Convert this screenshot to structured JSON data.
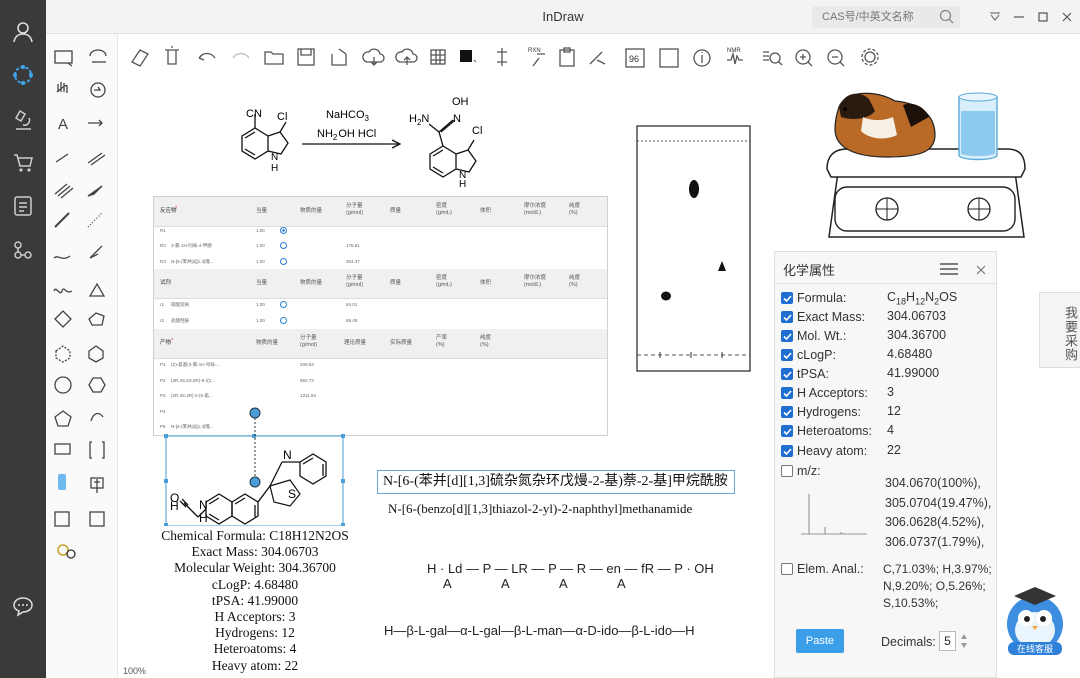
{
  "app": {
    "title": "InDraw"
  },
  "search": {
    "placeholder": "CAS号/中英文名称"
  },
  "rail": {
    "icons": [
      "user-icon",
      "molecule-icon",
      "microscope-icon",
      "cart-icon",
      "document-icon",
      "network-icon",
      "chat-icon"
    ]
  },
  "scheme": {
    "reagent1": "NaHCO",
    "reagent1_sub": "3",
    "reagent2": "NH",
    "reagent2_sub": "2",
    "reagent2_rest": "OH HCl",
    "reactant_labels": {
      "cn": "CN",
      "cl": "Cl",
      "nh": "N",
      "h": "H"
    },
    "product_labels": {
      "oh": "OH",
      "n": "N",
      "h2n": "H",
      "h2n_sub": "2",
      "h2n_n": "N",
      "cl": "Cl",
      "nh": "N",
      "h": "H"
    }
  },
  "table": {
    "reactants": {
      "title": "反应物",
      "headers": [
        "当量",
        "物质的量",
        "分子量 (g/mol)",
        "质量",
        "密度 (g/mL)",
        "体积",
        "摩尔浓度 (mol/L)",
        "纯度 (%)"
      ],
      "rows": [
        {
          "id": "R1",
          "name": "",
          "eq": "1.00",
          "mw": ""
        },
        {
          "id": "R2",
          "name": "3-氯-1H-吲哚-4-甲腈",
          "eq": "1.00",
          "mw": "176.61"
        },
        {
          "id": "R3",
          "name": "N-[6-(苯并[d][1,3]噻...",
          "eq": "1.00",
          "mw": "304.37"
        }
      ]
    },
    "reagents": {
      "title": "试剂",
      "headers": [
        "当量",
        "物质的量",
        "分子量 (g/mol)",
        "质量",
        "密度 (g/mL)",
        "体积",
        "摩尔浓度 (mol/L)",
        "纯度 (%)"
      ],
      "rows": [
        {
          "id": "r1",
          "name": "碳酸氢钠",
          "eq": "1.00",
          "mw": "84.01"
        },
        {
          "id": "r2",
          "name": "盐酸羟胺",
          "eq": "1.00",
          "mw": "69.49"
        }
      ]
    },
    "products": {
      "title": "产物",
      "headers": [
        "物质的量",
        "分子量 (g/mol)",
        "理论质量",
        "实际质量",
        "产率 (%)",
        "纯度 (%)"
      ],
      "rows": [
        {
          "id": "P1",
          "name": "(Z)-氨基(3-氯-1H-吲哚-...",
          "mw": "209.64"
        },
        {
          "id": "P2",
          "name": "(3R,4S,5S,6R)-6-((2...",
          "mw": "892.72"
        },
        {
          "id": "P3",
          "name": "(2R,3S,4R)-2-(6-氨...",
          "mw": "1311.94"
        },
        {
          "id": "P4",
          "name": "",
          "mw": ""
        },
        {
          "id": "P5",
          "name": "N-[6-(苯并[d][1,3]噻...",
          "mw": ""
        }
      ]
    }
  },
  "molecule": {
    "labels": {
      "o": "O",
      "h": "H",
      "n": "N",
      "hn": "H",
      "n2": "N",
      "s": "S"
    },
    "properties_text": [
      "Chemical Formula: C18H12N2OS",
      "Exact Mass: 304.06703",
      "Molecular Weight: 304.36700",
      "cLogP: 4.68480",
      "tPSA: 41.99000",
      "H Acceptors: 3",
      "Hydrogens: 12",
      "Heteroatoms: 4",
      "Heavy atom: 22"
    ]
  },
  "names": {
    "cn": "N-[6-(苯并[d][1,3]硫杂氮杂环戊熳-2-基)萘-2-基]甲烷酰胺",
    "en": "N-[6-(benzo[d][1,3]thiazol-2-yl)-2-naphthyl]methanamide"
  },
  "peptide": {
    "line": "H-Ld-P-LR-P-R-en-fR-P-OH",
    "display": "H · Ld — P — LR — P — R — en — fR — P · OH",
    "sub_marks": [
      "A",
      "A",
      "A",
      "A"
    ]
  },
  "sugar": {
    "line": "H-β-L-gal-α-L-gal-β-L-man-α-D-ido-β-L-ido-H",
    "display": "H—β-L-gal—α-L-gal—β-L-man—α-D-ido—β-L-ido—H"
  },
  "props": {
    "title": "化学属性",
    "rows": [
      {
        "label": "Formula:",
        "value": "C18H12N2OS",
        "checked": true
      },
      {
        "label": "Exact Mass:",
        "value": "304.06703",
        "checked": true
      },
      {
        "label": "Mol. Wt.:",
        "value": "304.36700",
        "checked": true
      },
      {
        "label": "cLogP:",
        "value": "4.68480",
        "checked": true
      },
      {
        "label": "tPSA:",
        "value": "41.99000",
        "checked": true
      },
      {
        "label": "H Acceptors:",
        "value": "3",
        "checked": true
      },
      {
        "label": "Hydrogens:",
        "value": "12",
        "checked": true
      },
      {
        "label": "Heteroatoms:",
        "value": "4",
        "checked": true
      },
      {
        "label": "Heavy atom:",
        "value": "22",
        "checked": true
      }
    ],
    "mz": {
      "label": "m/z:",
      "checked": false,
      "values": [
        "304.0670(100%),",
        "305.0704(19.47%),",
        "306.0628(4.52%),",
        "306.0737(1.79%),"
      ]
    },
    "elem": {
      "label": "Elem. Anal.:",
      "checked": false,
      "values": [
        "C,71.03%; H,3.97%;",
        "N,9.20%; O,5.26%;",
        "S,10.53%;"
      ]
    },
    "paste_label": "Paste",
    "decimals_label": "Decimals:",
    "decimals_value": "5"
  },
  "purchase_label": "我要采购",
  "service_label": "在线客服",
  "zoom": "100%",
  "colors": {
    "accent": "#1f6fd1",
    "paste": "#3b9ee8",
    "rail": "#3a3a3a",
    "selection": "#4a9fd8"
  }
}
